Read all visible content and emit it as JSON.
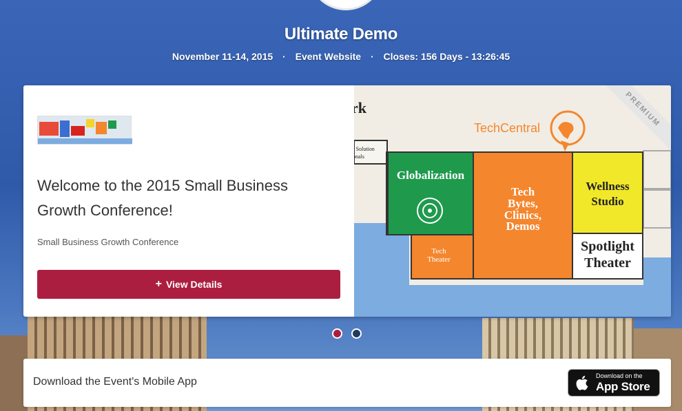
{
  "event": {
    "title": "Ultimate Demo",
    "dates": "November 11-14, 2015",
    "website_link": "Event Website",
    "closes_label": "Closes:",
    "countdown": "156 Days - 13:26:45",
    "separator": "·"
  },
  "carousel": {
    "heading": "Welcome to the 2015 Small Business Growth Conference!",
    "subtitle": "Small Business Growth Conference",
    "button_label": "View Details",
    "button_icon": "+",
    "badge": "PREMIUM",
    "active_slide": 1,
    "slide_count": 2,
    "map": {
      "partial_label": "rk",
      "solution_label_1": "r Solution",
      "solution_label_2": "onals",
      "techcentral": "TechCentral",
      "zones": {
        "globalization": "Globalization",
        "tech_bytes": [
          "Tech",
          "Bytes,",
          "Clinics,",
          "Demos"
        ],
        "wellness": [
          "Wellness",
          "Studio"
        ],
        "spotlight": [
          "Spotlight",
          "Theater"
        ],
        "tech_theater": [
          "Tech",
          "Theater"
        ]
      }
    }
  },
  "app_bar": {
    "text": "Download the Event's Mobile App",
    "badge_small": "Download on the",
    "badge_big": "App Store"
  },
  "colors": {
    "accent": "#ac1e3f",
    "orange": "#f4862e",
    "green": "#1f9a4d",
    "yellow": "#f2e82a",
    "water": "#7cace0"
  }
}
